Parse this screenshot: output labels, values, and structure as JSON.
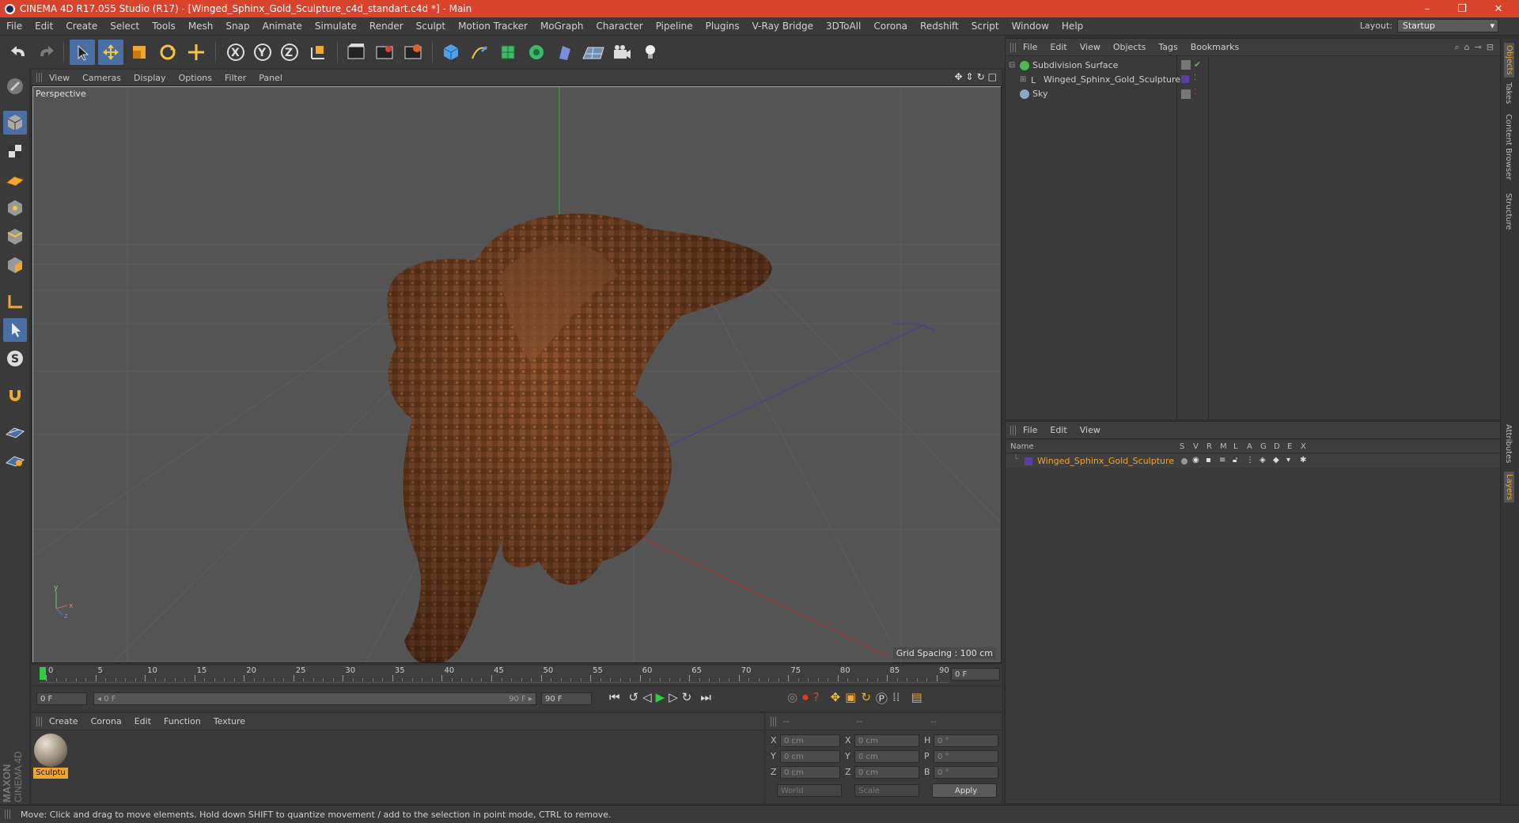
{
  "window": {
    "title": "CINEMA 4D R17.055 Studio (R17) - [Winged_Sphinx_Gold_Sculpture_c4d_standart.c4d *] - Main",
    "minimize_glyph": "–",
    "restore_glyph": "❐",
    "close_glyph": "✕"
  },
  "menu": [
    "File",
    "Edit",
    "Create",
    "Select",
    "Tools",
    "Mesh",
    "Snap",
    "Animate",
    "Simulate",
    "Render",
    "Sculpt",
    "Motion Tracker",
    "MoGraph",
    "Character",
    "Pipeline",
    "Plugins",
    "V-Ray Bridge",
    "3DToAll",
    "Corona",
    "Redshift",
    "Script",
    "Window",
    "Help"
  ],
  "layout": {
    "label": "Layout:",
    "value": "Startup"
  },
  "viewport": {
    "menu": [
      "View",
      "Cameras",
      "Display",
      "Options",
      "Filter",
      "Panel"
    ],
    "label": "Perspective",
    "grid_spacing": "Grid Spacing : 100 cm"
  },
  "timeline": {
    "ticks": [
      "0",
      "5",
      "10",
      "15",
      "20",
      "25",
      "30",
      "35",
      "40",
      "45",
      "50",
      "55",
      "60",
      "65",
      "70",
      "75",
      "80",
      "85",
      "90"
    ],
    "end_field": "0 F"
  },
  "transport": {
    "current_frame": "0 F",
    "range_start": "◂ 0 F",
    "range_end": "90 F ▸",
    "max_frame": "90 F"
  },
  "material_manager": {
    "menu": [
      "Create",
      "Corona",
      "Edit",
      "Function",
      "Texture"
    ],
    "material_name": "Sculptu"
  },
  "coordinates": {
    "headers": [
      "--",
      "--",
      "--"
    ],
    "rows": [
      {
        "a": "X",
        "av": "0 cm",
        "b": "X",
        "bv": "0 cm",
        "c": "H",
        "cv": "0 °"
      },
      {
        "a": "Y",
        "av": "0 cm",
        "b": "Y",
        "bv": "0 cm",
        "c": "P",
        "cv": "0 °"
      },
      {
        "a": "Z",
        "av": "0 cm",
        "b": "Z",
        "bv": "0 cm",
        "c": "B",
        "cv": "0 °"
      }
    ],
    "mode1": "World",
    "mode2": "Scale",
    "apply": "Apply"
  },
  "object_manager": {
    "menu": [
      "File",
      "Edit",
      "View",
      "Objects",
      "Tags",
      "Bookmarks"
    ],
    "objects": [
      {
        "name": "Subdivision Surface",
        "color": "#4fb84f"
      },
      {
        "name": "Winged_Sphinx_Gold_Sculpture",
        "color": "#cfcfcf"
      },
      {
        "name": "Sky",
        "color": "#8aa6c8"
      }
    ]
  },
  "layer_manager": {
    "menu": [
      "File",
      "Edit",
      "View"
    ],
    "columns": [
      "Name",
      "S",
      "V",
      "R",
      "M",
      "L",
      "A",
      "G",
      "D",
      "E",
      "X"
    ],
    "layer_name": "Winged_Sphinx_Gold_Sculpture",
    "layer_color": "#f2a52a"
  },
  "right_tabs": [
    "Objects",
    "Takes",
    "Content Browser",
    "Structure",
    "Attributes",
    "Layers"
  ],
  "branding": {
    "line1": "MAXON",
    "line2": "CINEMA 4D"
  },
  "status": "Move: Click and drag to move elements. Hold down SHIFT to quantize movement / add to the selection in point mode, CTRL to remove.",
  "colors": {
    "accent": "#d9432b",
    "selected": "#4a6fa5",
    "play": "#2ecc40"
  }
}
